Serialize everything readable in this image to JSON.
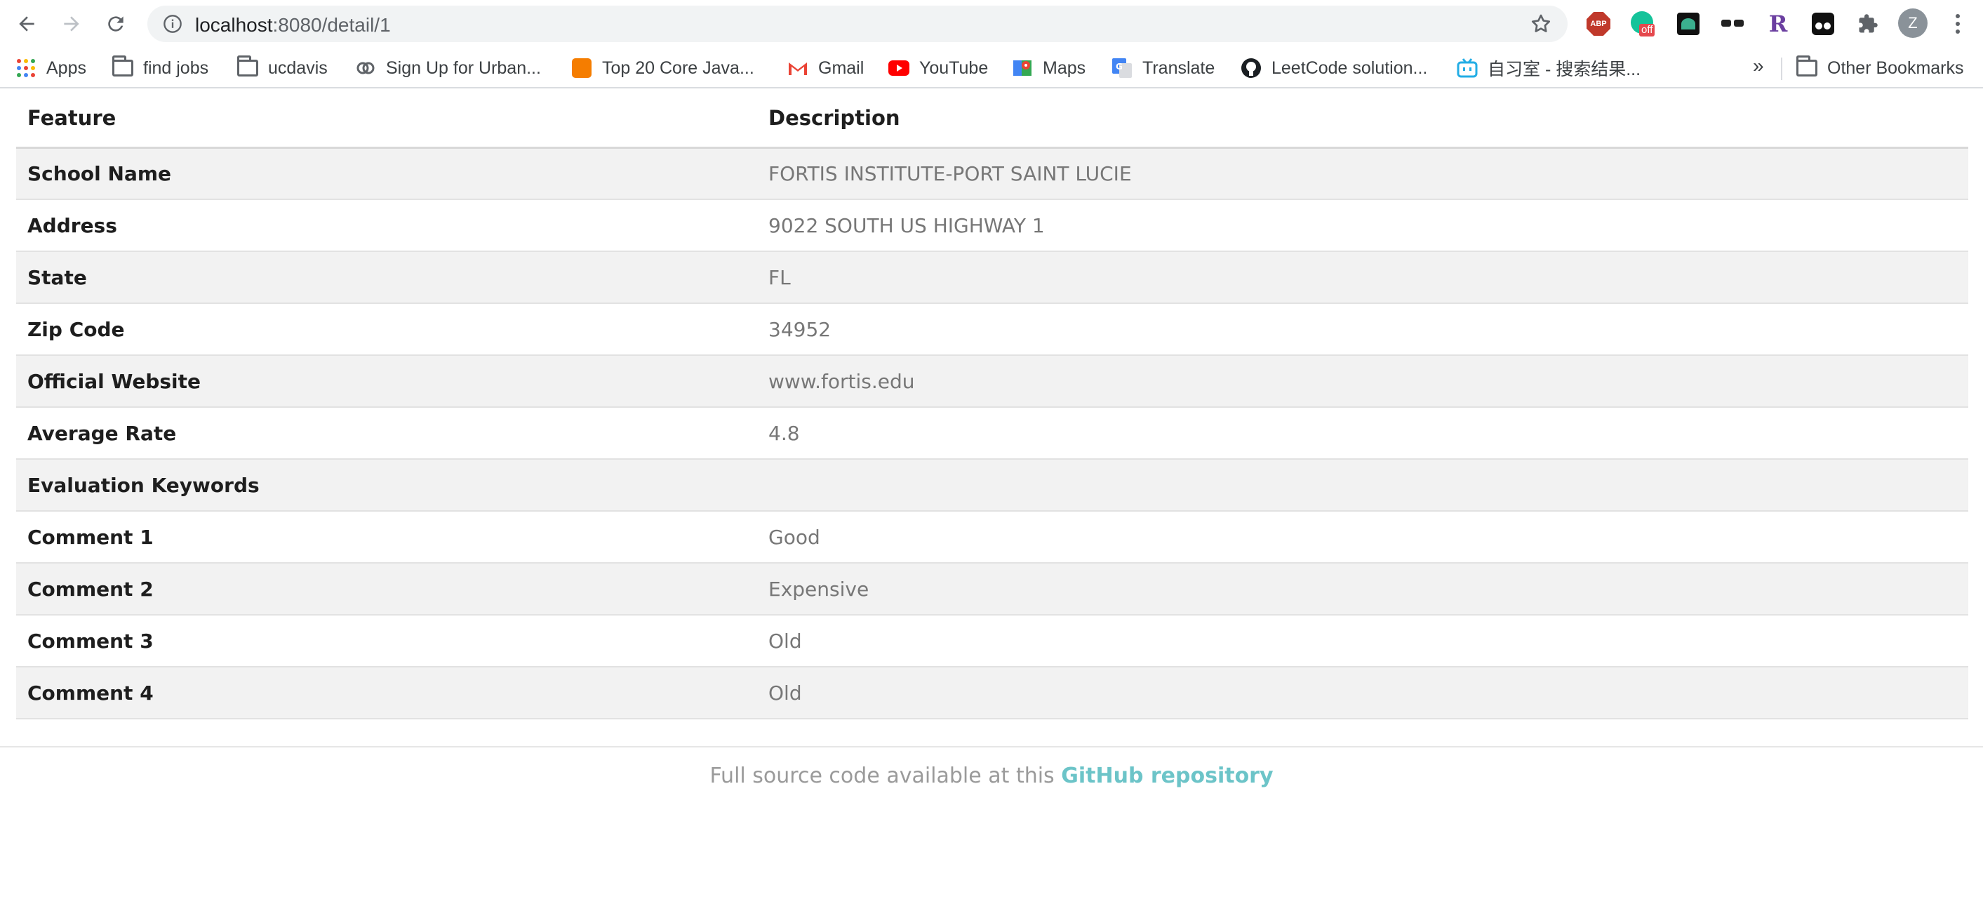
{
  "browser": {
    "url_host": "localhost",
    "url_path": ":8080/detail/1",
    "avatar_letter": "Z",
    "extensions": {
      "abp_label": "ABP",
      "grammarly_badge": "off"
    }
  },
  "bookmarks": {
    "items": [
      {
        "label": "Apps",
        "icon": "apps-grid-icon"
      },
      {
        "label": "find jobs",
        "icon": "folder-icon"
      },
      {
        "label": "ucdavis",
        "icon": "folder-icon"
      },
      {
        "label": "Sign Up for Urban...",
        "icon": "link-icon"
      },
      {
        "label": "Top 20 Core Java...",
        "icon": "blogger-icon"
      },
      {
        "label": "Gmail",
        "icon": "gmail-icon"
      },
      {
        "label": "YouTube",
        "icon": "youtube-icon"
      },
      {
        "label": "Maps",
        "icon": "maps-icon"
      },
      {
        "label": "Translate",
        "icon": "translate-icon"
      },
      {
        "label": "LeetCode solution...",
        "icon": "github-icon"
      },
      {
        "label": "自习室 - 搜索结果...",
        "icon": "bilibili-icon"
      }
    ],
    "more": "»",
    "other_bookmarks": "Other Bookmarks"
  },
  "table": {
    "header_feature": "Feature",
    "header_description": "Description",
    "rows": [
      {
        "feature": "School Name",
        "description": "FORTIS INSTITUTE-PORT SAINT LUCIE"
      },
      {
        "feature": "Address",
        "description": "9022 SOUTH US HIGHWAY 1"
      },
      {
        "feature": "State",
        "description": "FL"
      },
      {
        "feature": "Zip Code",
        "description": "34952"
      },
      {
        "feature": "Official Website",
        "description": "www.fortis.edu"
      },
      {
        "feature": "Average Rate",
        "description": "4.8"
      },
      {
        "feature": "Evaluation Keywords",
        "description": ""
      },
      {
        "feature": "Comment 1",
        "description": "Good"
      },
      {
        "feature": "Comment 2",
        "description": "Expensive"
      },
      {
        "feature": "Comment 3",
        "description": "Old"
      },
      {
        "feature": "Comment 4",
        "description": "Old"
      }
    ]
  },
  "footer": {
    "text": "Full source code available at this ",
    "link": "GitHub repository"
  },
  "colors": {
    "accent_link": "#6cc4c8",
    "row_stripe": "#f2f2f2"
  }
}
